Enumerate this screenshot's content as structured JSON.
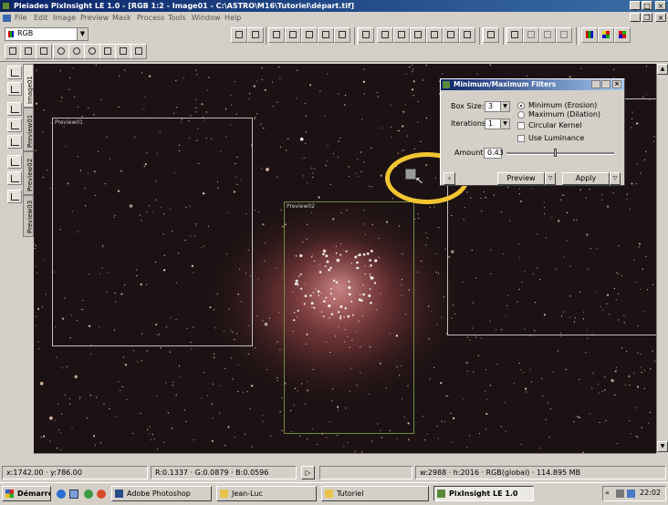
{
  "window": {
    "title": "Pleiades PixInsight LE 1.0 - [RGB 1:2 - Image01 - C:\\ASTRO\\M16\\Tutoriel\\départ.tif]"
  },
  "menu": [
    "File",
    "Edit",
    "Image",
    "Preview",
    "Mask",
    "Process",
    "Tools",
    "Window",
    "Help"
  ],
  "toolbar": {
    "color_space_value": "RGB"
  },
  "image_tabs": [
    "Image01",
    "Preview01",
    "Preview02",
    "Preview03"
  ],
  "previews": {
    "preview01_label": "Preview01",
    "preview02_label": "Preview02"
  },
  "dialog": {
    "title": "Minimum/Maximum Filters",
    "box_size_label": "Box Size:",
    "box_size_value": "3",
    "iterations_label": "Iterations:",
    "iterations_value": "1",
    "option_minimum": "Minimum (Erosion)",
    "option_maximum": "Maximum (Dilation)",
    "selected_option": "Minimum (Erosion)",
    "circular_kernel_label": "Circular Kernel",
    "use_luminance_label": "Use Luminance",
    "amount_label": "Amount:",
    "amount_value": "0.43",
    "preview_button": "Preview",
    "apply_button": "Apply"
  },
  "status": {
    "coords": "x:1742.00 · y:786.00",
    "rgb_values": "R:0.1337 · G:0.0879 · B:0.0596",
    "image_info": "w:2988 · h:2016 · RGB(global) · 114.895 MB"
  },
  "taskbar": {
    "start_label": "Démarrer",
    "tasks": [
      "Adobe Photoshop",
      "Jean-Luc",
      "Tutoriel",
      "PixInsight LE 1.0"
    ],
    "active_task": "PixInsight LE 1.0",
    "clock": "22:02"
  },
  "colors": {
    "highlight_circle": "#f2c531",
    "preview02_border": "#6f8a3a",
    "preview_border": "#bfbfbf",
    "titlebar": "#0a246a"
  }
}
